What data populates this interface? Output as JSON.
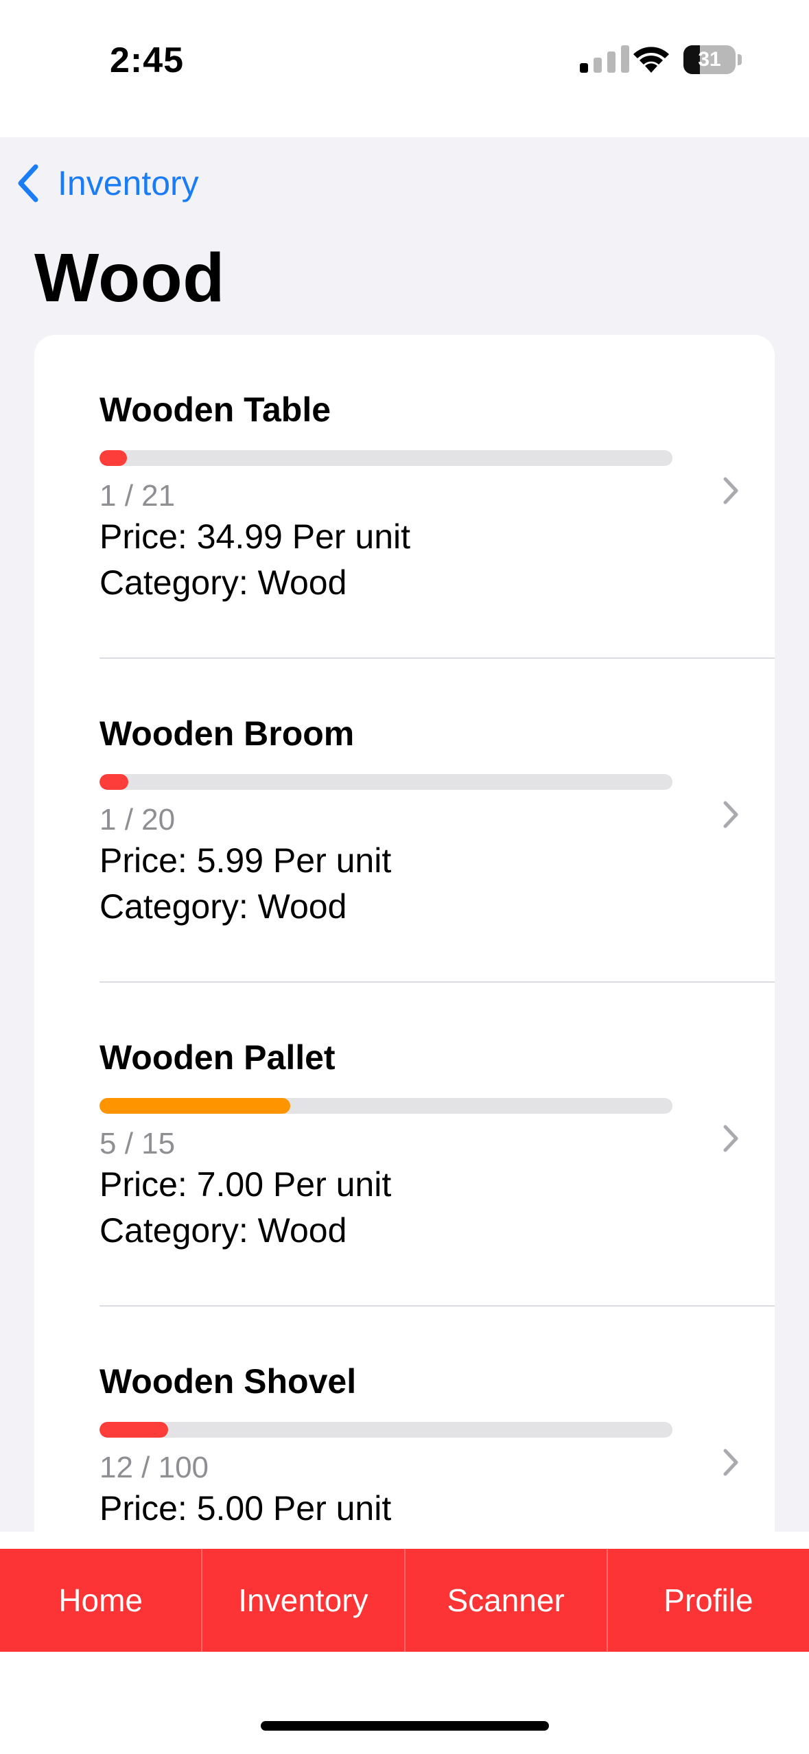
{
  "status_bar": {
    "time": "2:45",
    "battery_level": "31"
  },
  "nav": {
    "back_label": "Inventory",
    "title": "Wood"
  },
  "items": [
    {
      "name": "Wooden Table",
      "quantity": "1 / 21",
      "fraction": 0.0476,
      "bar_color": "#fc3d39",
      "price": "Price: 34.99 Per unit",
      "category": "Category: Wood"
    },
    {
      "name": "Wooden Broom",
      "quantity": "1 / 20",
      "fraction": 0.05,
      "bar_color": "#fc3d39",
      "price": "Price: 5.99 Per unit",
      "category": "Category: Wood"
    },
    {
      "name": "Wooden Pallet",
      "quantity": "5 / 15",
      "fraction": 0.3333,
      "bar_color": "#fe9500",
      "price": "Price: 7.00 Per unit",
      "category": "Category: Wood"
    },
    {
      "name": "Wooden Shovel",
      "quantity": "12 / 100",
      "fraction": 0.12,
      "bar_color": "#fc3d39",
      "price": "Price: 5.00 Per unit",
      "category": ""
    }
  ],
  "tabs": [
    {
      "label": "Home"
    },
    {
      "label": "Inventory"
    },
    {
      "label": "Scanner"
    },
    {
      "label": "Profile"
    }
  ],
  "colors": {
    "accent": "#1a7cf6",
    "tab_bar": "#fc3436",
    "background": "#f2f2f7"
  }
}
